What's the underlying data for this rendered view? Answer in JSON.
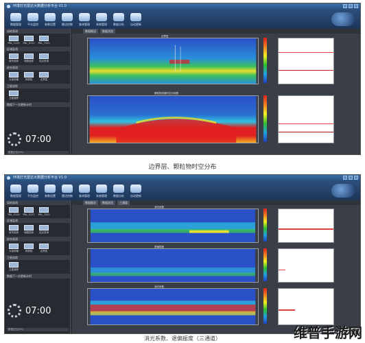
{
  "screens": [
    {
      "window_title": "环境灯光雷达大数据分析平台 V1.0",
      "toolbar": [
        "数据管理",
        "平台监控",
        "参数设置",
        "雷达控制",
        "查询管理",
        "系统管理",
        "数据分析",
        "自动更新"
      ],
      "logo_text": "",
      "left_sections": [
        {
          "title": "局地观测",
          "buttons": [
            "PBL_5125",
            "PBL_5231",
            "PBL_7020"
          ]
        },
        {
          "title": "区域监测",
          "buttons": [
            "城市选择",
            "地图选择",
            "站点查询"
          ]
        },
        {
          "title": "综合观测",
          "buttons": [
            "污染传输",
            "风廓线",
            "边界层"
          ]
        },
        {
          "title": "卫星追踪",
          "buttons": [
            "卫星追踪"
          ]
        }
      ],
      "clock_label": "数据下一次更新计时",
      "clock_time": "07:00",
      "status_text": "数据正在(6%)",
      "tabs": [
        "数据概况",
        "数据浏览"
      ],
      "panels": [
        {
          "title": "边界层",
          "colorbar_top": "4.0"
        },
        {
          "title": "颗粒物浓度时空分布图",
          "colorbar_top": "1.00"
        }
      ]
    },
    {
      "window_title": "环境灯光雷达大数据分析平台 V1.0",
      "toolbar": [
        "数据管理",
        "平台监控",
        "参数设置",
        "雷达控制",
        "查询管理",
        "系统管理",
        "数据分析",
        "自动更新"
      ],
      "logo_text": "",
      "left_sections": [
        {
          "title": "局地观测",
          "buttons": [
            "PBL_5125",
            "PBL_5231",
            "PBL_7020"
          ]
        },
        {
          "title": "区域监测",
          "buttons": [
            "城市选择",
            "地图选择",
            "站点查询"
          ]
        },
        {
          "title": "综合观测",
          "buttons": [
            "污染传输",
            "风廓线",
            "边界层"
          ]
        },
        {
          "title": "卫星追踪",
          "buttons": [
            "卫星追踪"
          ]
        }
      ],
      "clock_label": "数据下一次更新计时",
      "clock_time": "07:00",
      "status_text": "数据正在(6%)",
      "tabs": [
        "数据概况",
        "数据浏览",
        "三通道"
      ],
      "panels": [
        {
          "title": "消光系数",
          "colorbar_top": "1.00"
        },
        {
          "title": "退偏振度",
          "colorbar_top": "0.50"
        },
        {
          "title": "消光系数",
          "colorbar_top": "4.00"
        }
      ]
    }
  ],
  "captions": [
    "边界层、颗粒物时空分布",
    "消光系数、退偏振度（三通道）"
  ],
  "watermark": "维普手游网",
  "colors": {
    "frame": "#2b2f36",
    "toolbar": "#1c3558",
    "heat_low": "#2a50c8",
    "heat_high": "#e02020"
  }
}
